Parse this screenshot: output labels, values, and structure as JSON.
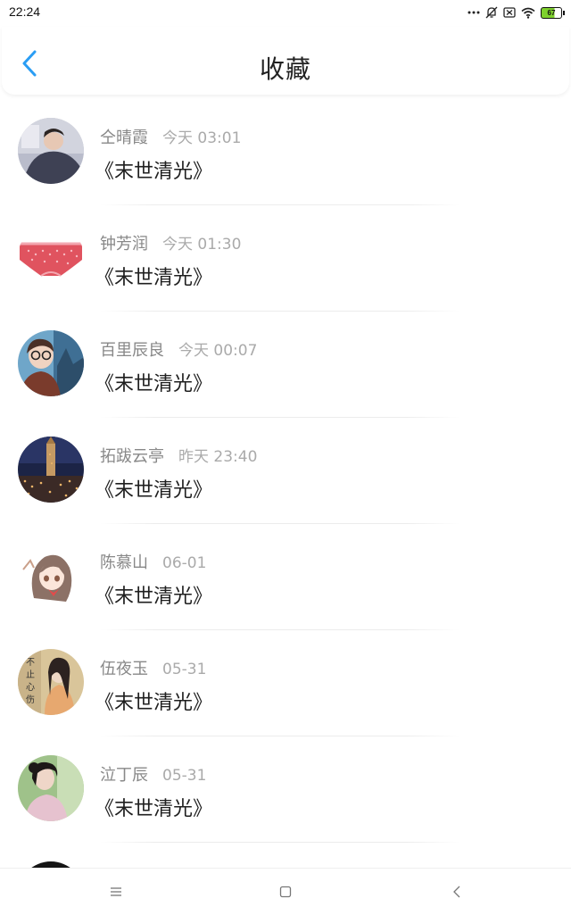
{
  "status_bar": {
    "time": "22:24",
    "battery_level": "67",
    "icons": [
      "more-dots-icon",
      "notifications-off-icon",
      "sim-off-icon",
      "wifi-icon",
      "battery-icon"
    ]
  },
  "header": {
    "title": "收藏",
    "back_icon": "chevron-left-icon",
    "accent_color": "#2a9df4"
  },
  "favorites": [
    {
      "name": "仝晴霞",
      "time": "今天 03:01",
      "book": "《末世清光》",
      "avatar": "avatar-person-lying"
    },
    {
      "name": "钟芳润",
      "time": "今天 01:30",
      "book": "《末世清光》",
      "avatar": "avatar-pink-garment"
    },
    {
      "name": "百里辰良",
      "time": "今天 00:07",
      "book": "《末世清光》",
      "avatar": "avatar-girl-glasses"
    },
    {
      "name": "拓跋云亭",
      "time": "昨天 23:40",
      "book": "《末世清光》",
      "avatar": "avatar-night-city"
    },
    {
      "name": "陈慕山",
      "time": "06-01",
      "book": "《末世清光》",
      "avatar": "avatar-anime-girl"
    },
    {
      "name": "伍夜玉",
      "time": "05-31",
      "book": "《末世清光》",
      "avatar": "avatar-poster-woman",
      "avatar_text": "不止心伤"
    },
    {
      "name": "泣丁辰",
      "time": "05-31",
      "book": "《末世清光》",
      "avatar": "avatar-woman-outdoor"
    }
  ],
  "nav_bar": {
    "buttons": [
      "menu-icon",
      "home-square-icon",
      "back-triangle-icon"
    ]
  }
}
